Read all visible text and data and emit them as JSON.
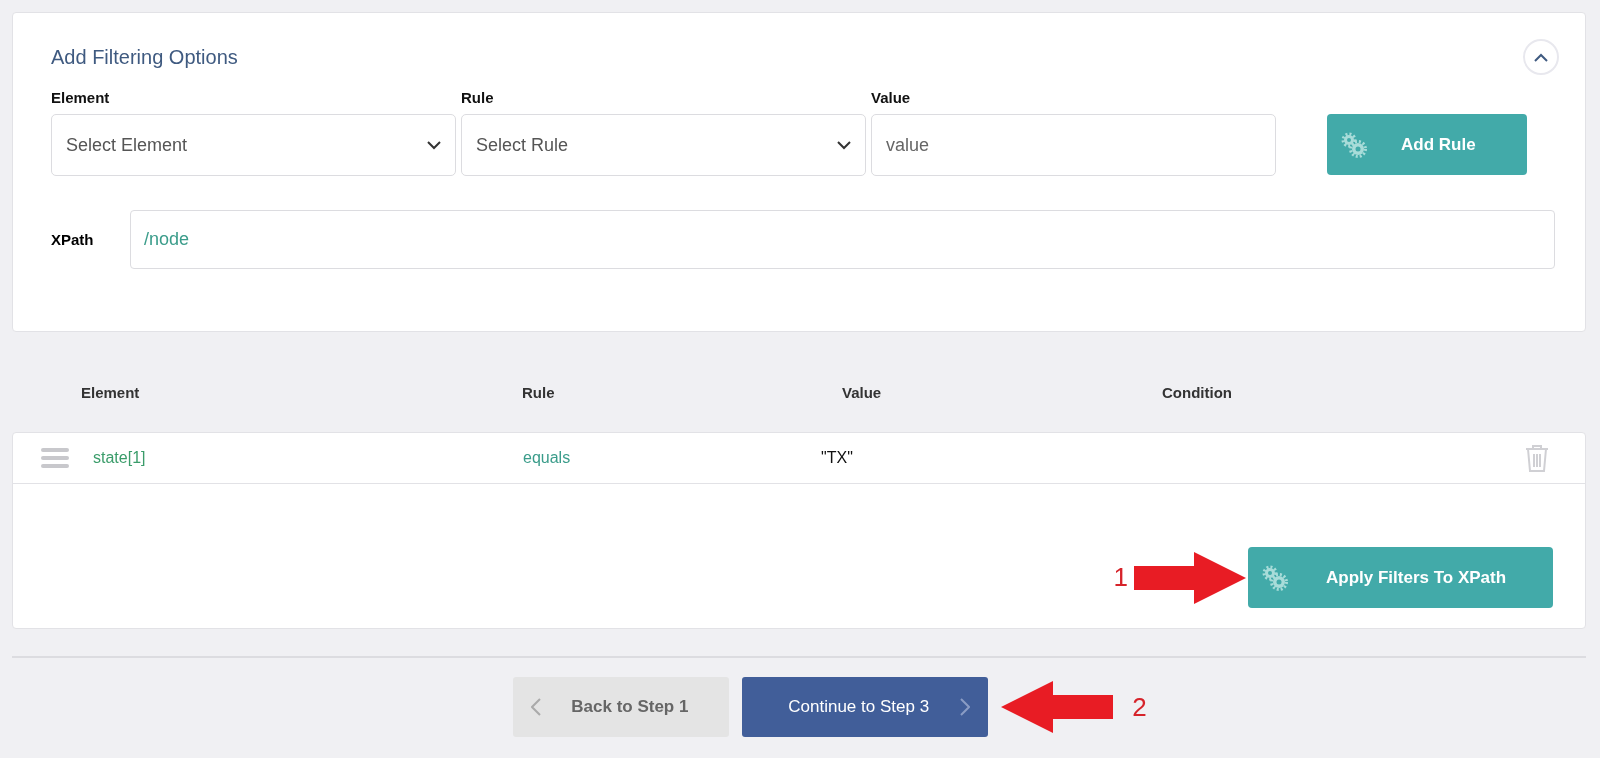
{
  "panel": {
    "title": "Add Filtering Options",
    "expanded": true,
    "fields": [
      {
        "label": "Element",
        "kind": "select",
        "placeholder": "Select Element"
      },
      {
        "label": "Rule",
        "kind": "select",
        "placeholder": "Select Rule"
      },
      {
        "label": "Value",
        "kind": "text",
        "placeholder": "value"
      }
    ],
    "add_button": "Add Rule",
    "xpath": {
      "label": "XPath",
      "value": "/node"
    }
  },
  "table": {
    "columns": [
      "Element",
      "Rule",
      "Value",
      "Condition"
    ],
    "rows": [
      {
        "element": "state[1]",
        "rule": "equals",
        "value": "\"TX\""
      }
    ]
  },
  "apply_button": "Apply Filters To XPath",
  "annotations": [
    {
      "label": "1"
    },
    {
      "label": "2"
    }
  ],
  "nav": {
    "back": "Back to Step 1",
    "back_disabled": true,
    "continue": "Continue to Step 3"
  }
}
